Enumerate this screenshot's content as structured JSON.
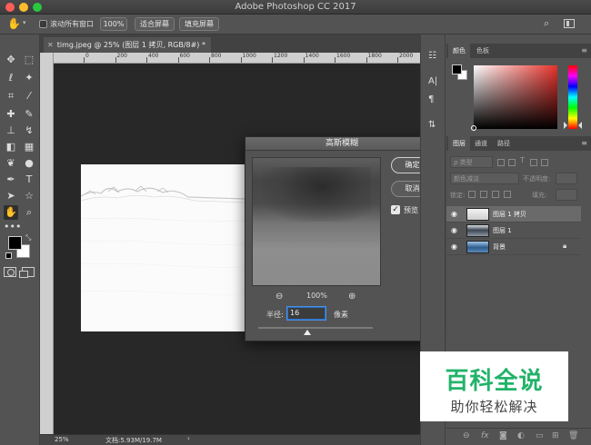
{
  "window": {
    "title": "Adobe Photoshop CC 2017"
  },
  "options_bar": {
    "scroll_all_windows_label": "滚动所有窗口",
    "zoom_100_label": "100%",
    "fit_screen_label": "适合屏幕",
    "fill_screen_label": "填充屏幕"
  },
  "document": {
    "tab_title": "timg.jpeg @ 25% (图层 1 拷贝, RGB/8#) *",
    "ruler_labels": [
      "0",
      "200",
      "400",
      "600",
      "800",
      "1000",
      "1200",
      "1400",
      "1600",
      "1800",
      "2000"
    ],
    "status_zoom": "25%",
    "status_doc": "文档:5.93M/19.7M"
  },
  "dialog": {
    "title": "高斯模糊",
    "ok_label": "确定",
    "cancel_label": "取消",
    "preview_label": "预览",
    "preview_checked": true,
    "zoom_level": "100%",
    "radius_label": "半径:",
    "radius_value": "16",
    "radius_unit": "像素"
  },
  "color_panel": {
    "tabs": [
      {
        "label": "颜色"
      },
      {
        "label": "色板"
      }
    ],
    "fg_color": "#000000",
    "bg_color": "#ffffff"
  },
  "layers_panel": {
    "tabs": [
      {
        "label": "图层"
      },
      {
        "label": "通道"
      },
      {
        "label": "路径"
      }
    ],
    "filter_label": "ρ 类型",
    "blend_mode": "颜色减淡",
    "opacity_label": "不透明度:",
    "lock_label": "锁定:",
    "fill_label": "填充:",
    "layers": [
      {
        "name": "图层 1 拷贝",
        "selected": true,
        "locked": false
      },
      {
        "name": "图层 1",
        "selected": false,
        "locked": false
      },
      {
        "name": "背景",
        "selected": false,
        "locked": true
      }
    ]
  },
  "watermark": {
    "title": "百科全说",
    "subtitle": "助你轻松解决"
  }
}
